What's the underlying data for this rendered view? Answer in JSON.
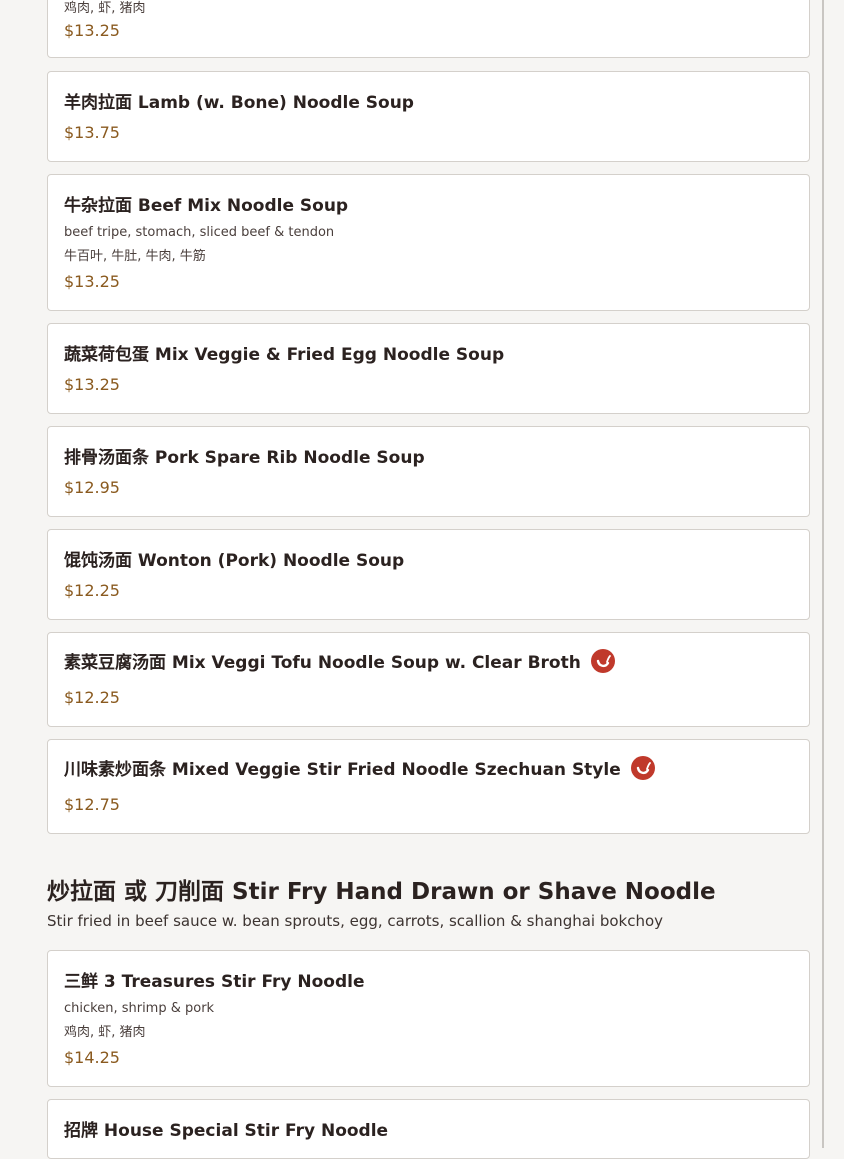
{
  "colors": {
    "background": "#f6f5f3",
    "card": "#ffffff",
    "card_border": "#d4d0cb",
    "price": "#8a5a1f",
    "spicy_badge": "#c0392b"
  },
  "top_card": {
    "desc_cn": "鸡肉, 虾, 猪肉",
    "price": "$13.25"
  },
  "items": [
    {
      "name": "羊肉拉面 Lamb (w. Bone) Noodle Soup",
      "price": "$13.75"
    },
    {
      "name": "牛杂拉面 Beef Mix Noodle Soup",
      "desc_en": "beef tripe, stomach, sliced beef & tendon",
      "desc_cn": "牛百叶, 牛肚, 牛肉, 牛筋",
      "price": "$13.25"
    },
    {
      "name": "蔬菜荷包蛋 Mix Veggie & Fried Egg Noodle Soup",
      "price": "$13.25"
    },
    {
      "name": "排骨汤面条 Pork Spare Rib Noodle Soup",
      "price": "$12.95"
    },
    {
      "name": "馄饨汤面 Wonton (Pork) Noodle Soup",
      "price": "$12.25"
    },
    {
      "name": "素菜豆腐汤面 Mix Veggi Tofu Noodle Soup w. Clear Broth",
      "price": "$12.25",
      "spicy_icon": "chili-pepper-icon"
    },
    {
      "name": "川味素炒面条 Mixed Veggie Stir Fried Noodle Szechuan Style",
      "price": "$12.75",
      "spicy_icon": "chili-pepper-icon"
    }
  ],
  "section": {
    "title": "炒拉面 或 刀削面 Stir Fry Hand Drawn or Shave Noodle",
    "description": "Stir fried in beef sauce w. bean sprouts, egg, carrots, scallion & shanghai bokchoy"
  },
  "section_items": [
    {
      "name": "三鲜 3 Treasures Stir Fry Noodle",
      "desc_en": "chicken, shrimp & pork",
      "desc_cn": "鸡肉, 虾, 猪肉",
      "price": "$14.25"
    },
    {
      "name": "招牌 House Special Stir Fry Noodle"
    }
  ]
}
